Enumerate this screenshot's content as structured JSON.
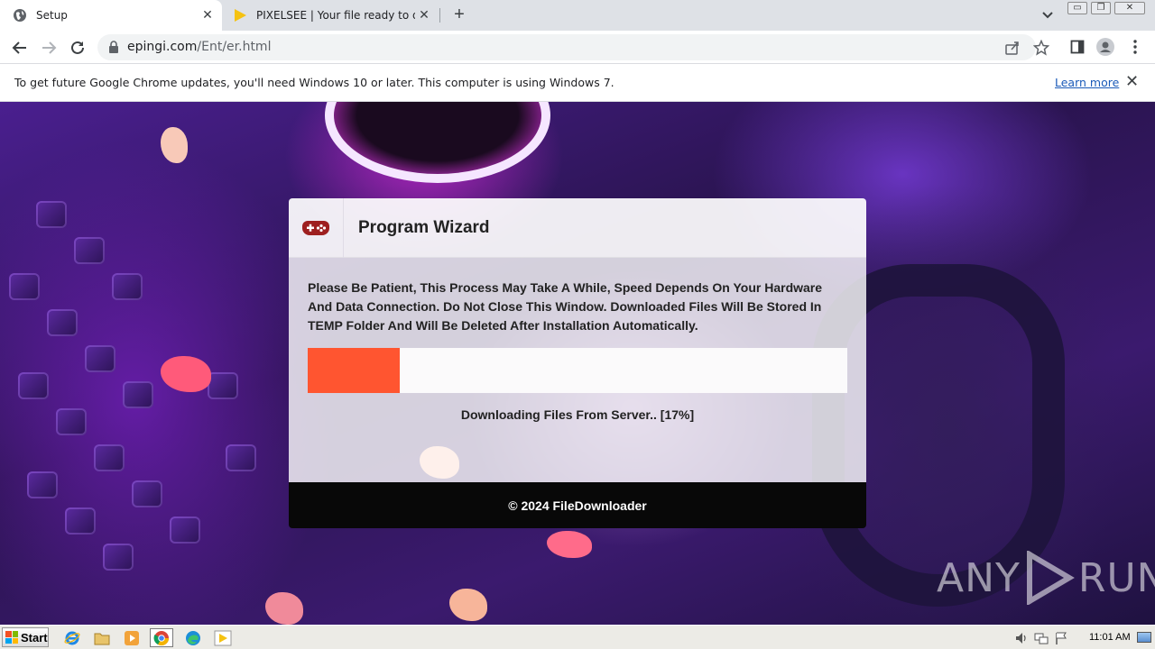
{
  "browser": {
    "tabs": [
      {
        "title": "Setup",
        "icon": "globe-icon",
        "active": true
      },
      {
        "title": "PIXELSEE | Your file ready to download",
        "icon": "pixelsee-play-icon",
        "active": false
      }
    ],
    "address": {
      "host": "epingi.com",
      "path": "/Ent/er.html"
    }
  },
  "infobar": {
    "message": "To get future Google Chrome updates, you'll need Windows 10 or later. This computer is using Windows 7.",
    "link": "Learn more"
  },
  "wizard": {
    "title": "Program Wizard",
    "icon": "gamepad-icon",
    "message": "Please Be Patient, This Process May Take A While, Speed Depends On Your Hardware And Data Connection. Do Not Close This Window. Downloaded Files Will Be Stored In TEMP Folder And Will Be Deleted After Installation Automatically.",
    "progress_percent": 17,
    "status": "Downloading Files From Server.. [17%]",
    "footer": "© 2024 FileDownloader"
  },
  "watermark": {
    "left": "ANY",
    "right": "RUN"
  },
  "taskbar": {
    "start_label": "Start",
    "apps": [
      "internet-explorer-icon",
      "folder-icon",
      "media-player-icon",
      "chrome-icon",
      "edge-icon",
      "pixelsee-play-icon"
    ],
    "clock": "11:01 AM"
  },
  "colors": {
    "progress": "#ff5530",
    "accent_link": "#1a5ab8",
    "footer_bg": "#080808"
  }
}
